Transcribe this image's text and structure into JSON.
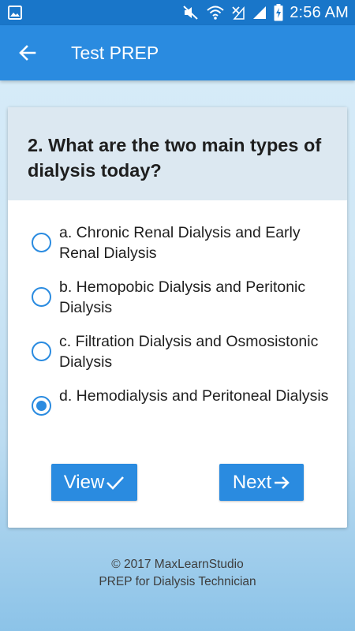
{
  "status_bar": {
    "time": "2:56 AM",
    "icons": [
      "gallery-icon",
      "mute-icon",
      "wifi-icon",
      "no-signal-icon",
      "signal-icon",
      "battery-charging-icon"
    ]
  },
  "app_bar": {
    "title": "Test PREP",
    "back_icon": "arrow-back-icon"
  },
  "question": {
    "text": "2. What are the two main types of dialysis today?"
  },
  "options": [
    {
      "label": "a. Chronic Renal Dialysis and Early Renal Dialysis",
      "checked": false
    },
    {
      "label": "b. Hemopobic Dialysis and Peritonic Dialysis",
      "checked": false
    },
    {
      "label": "c. Filtration Dialysis and Osmosistonic Dialysis",
      "checked": false
    },
    {
      "label": "d. Hemodialysis and Peritoneal Dialysis",
      "checked": true
    }
  ],
  "buttons": {
    "view_label": "View",
    "view_icon": "check-icon",
    "next_label": "Next",
    "next_icon": "arrow-forward-icon"
  },
  "footer": {
    "line1": "© 2017 MaxLearnStudio",
    "line2": "PREP for Dialysis Technician"
  },
  "colors": {
    "status_bar": "#1976c9",
    "app_bar": "#2a8be0",
    "accent": "#2a8be0",
    "question_bg": "#dce8f1"
  }
}
